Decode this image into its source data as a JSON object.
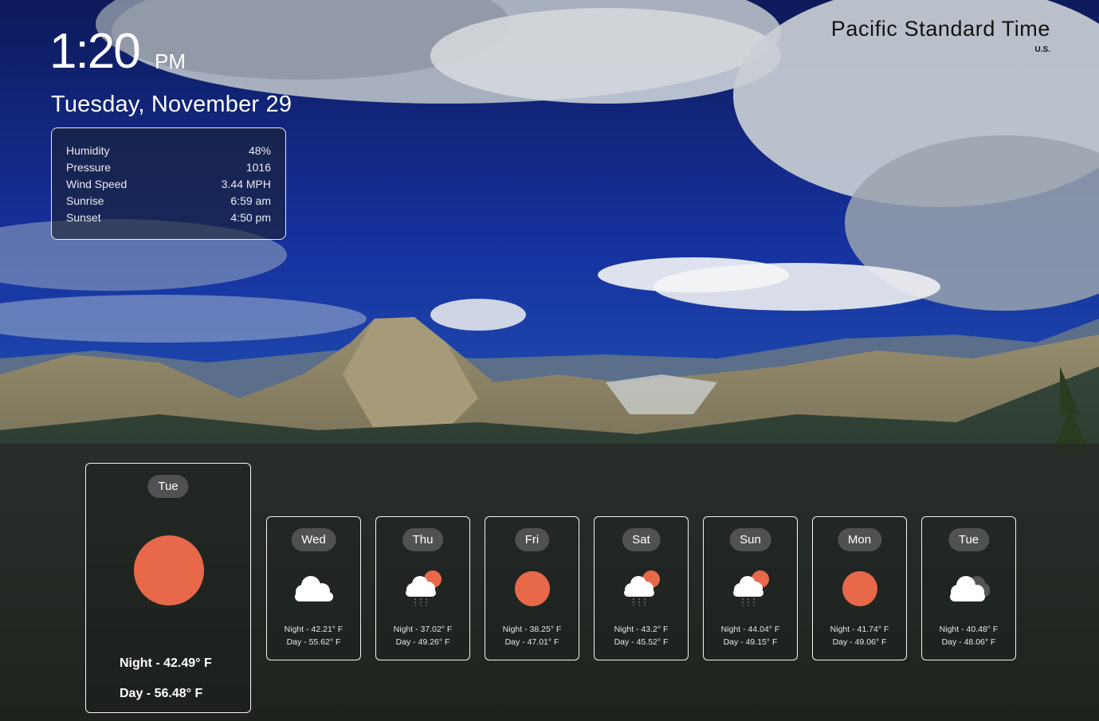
{
  "clock": {
    "time": "1:20",
    "ampm": "PM",
    "date": "Tuesday, November 29"
  },
  "timezone": {
    "name": "Pacific Standard Time",
    "country": "U.S."
  },
  "details": [
    {
      "label": "Humidity",
      "value": "48%"
    },
    {
      "label": "Pressure",
      "value": "1016"
    },
    {
      "label": "Wind Speed",
      "value": "3.44 MPH"
    },
    {
      "label": "Sunrise",
      "value": "6:59 am"
    },
    {
      "label": "Sunset",
      "value": "4:50 pm"
    }
  ],
  "today": {
    "day": "Tue",
    "icon": "sun-icon",
    "night": "Night - 42.49° F",
    "day_temp": "Day - 56.48° F"
  },
  "forecast": [
    {
      "day": "Wed",
      "icon": "cloud-icon",
      "night": "Night - 42.21° F",
      "day_temp": "Day - 55.62° F"
    },
    {
      "day": "Thu",
      "icon": "rain-sun-icon",
      "night": "Night - 37.02° F",
      "day_temp": "Day - 49.26° F"
    },
    {
      "day": "Fri",
      "icon": "sun-icon",
      "night": "Night - 38.25° F",
      "day_temp": "Day - 47.01° F"
    },
    {
      "day": "Sat",
      "icon": "rain-sun-icon",
      "night": "Night - 43.2° F",
      "day_temp": "Day - 45.52° F"
    },
    {
      "day": "Sun",
      "icon": "rain-sun-icon",
      "night": "Night - 44.04° F",
      "day_temp": "Day - 49.15° F"
    },
    {
      "day": "Mon",
      "icon": "sun-icon",
      "night": "Night - 41.74° F",
      "day_temp": "Day - 49.06° F"
    },
    {
      "day": "Tue",
      "icon": "clouds-icon",
      "night": "Night - 40.48° F",
      "day_temp": "Day - 48.06° F"
    }
  ],
  "colors": {
    "sun": "#e8694a",
    "cloud": "#ffffff",
    "pill": "#555558"
  }
}
